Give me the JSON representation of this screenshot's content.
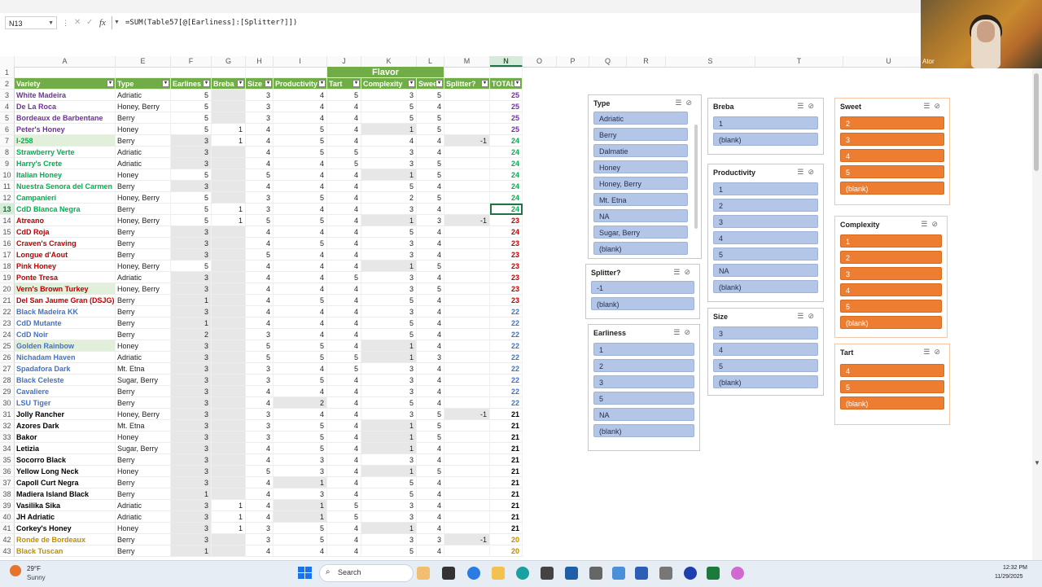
{
  "formula_bar": {
    "name_box": "N13",
    "formula": "=SUM(Table57[@[Earliness]:[Splitter?]])",
    "fx_label": "fx"
  },
  "columns": [
    "A",
    "E",
    "F",
    "G",
    "H",
    "I",
    "J",
    "K",
    "L",
    "M",
    "N",
    "O",
    "P",
    "Q",
    "R",
    "S",
    "T",
    "U"
  ],
  "selected_column": "N",
  "selected_row": "13",
  "flavor_header": "Flavor",
  "table_headers": [
    "Variety",
    "Type",
    "Earlines",
    "Breba",
    "Size",
    "Productivity",
    "Tart",
    "Complexity",
    "Swee",
    "Splitter?",
    "TOTAL"
  ],
  "rows": [
    {
      "n": "1",
      "cells": [
        "",
        "",
        "",
        "",
        "",
        "",
        "",
        "",
        "",
        "",
        ""
      ]
    },
    {
      "n": "2",
      "cells": [
        "",
        "",
        "",
        "",
        "",
        "",
        "",
        "",
        "",
        "",
        ""
      ]
    },
    {
      "n": "3",
      "cells": [
        "White Madeira",
        "Adriatic",
        "5",
        "",
        "3",
        "4",
        "5",
        "3",
        "5",
        "",
        "25"
      ],
      "color": "#7030a0"
    },
    {
      "n": "4",
      "cells": [
        "De La Roca",
        "Honey, Berry",
        "5",
        "",
        "3",
        "4",
        "4",
        "5",
        "4",
        "",
        "25"
      ],
      "color": "#7030a0"
    },
    {
      "n": "5",
      "cells": [
        "Bordeaux de Barbentane",
        "Berry",
        "5",
        "",
        "3",
        "4",
        "4",
        "5",
        "5",
        "",
        "25"
      ],
      "color": "#7030a0"
    },
    {
      "n": "6",
      "cells": [
        "Peter's Honey",
        "Honey",
        "5",
        "1",
        "4",
        "5",
        "4",
        "1",
        "5",
        "",
        "25"
      ],
      "color": "#7030a0"
    },
    {
      "n": "7",
      "cells": [
        "I-258",
        "Berry",
        "3",
        "1",
        "4",
        "5",
        "4",
        "4",
        "4",
        "-1",
        "24"
      ],
      "color": "#00b050"
    },
    {
      "n": "8",
      "cells": [
        "Strawberry Verte",
        "Adriatic",
        "3",
        "",
        "4",
        "5",
        "5",
        "3",
        "4",
        "",
        "24"
      ],
      "color": "#00b050"
    },
    {
      "n": "9",
      "cells": [
        "Harry's Crete",
        "Adriatic",
        "3",
        "",
        "4",
        "4",
        "5",
        "3",
        "5",
        "",
        "24"
      ],
      "color": "#00b050"
    },
    {
      "n": "10",
      "cells": [
        "Italian Honey",
        "Honey",
        "5",
        "",
        "5",
        "4",
        "4",
        "1",
        "5",
        "",
        "24"
      ],
      "color": "#00b050"
    },
    {
      "n": "11",
      "cells": [
        "Nuestra Senora del Carmen",
        "Berry",
        "3",
        "",
        "4",
        "4",
        "4",
        "5",
        "4",
        "",
        "24"
      ],
      "color": "#00b050"
    },
    {
      "n": "12",
      "cells": [
        "Campanieri",
        "Honey, Berry",
        "5",
        "",
        "3",
        "5",
        "4",
        "2",
        "5",
        "",
        "24"
      ],
      "color": "#00b050"
    },
    {
      "n": "13",
      "cells": [
        "CdD Blanca Negra",
        "Berry",
        "5",
        "1",
        "3",
        "4",
        "4",
        "3",
        "4",
        "",
        "24"
      ],
      "color": "#00b050"
    },
    {
      "n": "14",
      "cells": [
        "Atreano",
        "Honey, Berry",
        "5",
        "1",
        "5",
        "5",
        "4",
        "1",
        "3",
        "-1",
        "23"
      ],
      "color": "#c00000"
    },
    {
      "n": "15",
      "cells": [
        "CdD Roja",
        "Berry",
        "3",
        "",
        "4",
        "4",
        "4",
        "5",
        "4",
        "",
        "24"
      ],
      "color": "#c00000"
    },
    {
      "n": "16",
      "cells": [
        "Craven's Craving",
        "Berry",
        "3",
        "",
        "4",
        "5",
        "4",
        "3",
        "4",
        "",
        "23"
      ],
      "color": "#c00000"
    },
    {
      "n": "17",
      "cells": [
        "Longue d'Aout",
        "Berry",
        "3",
        "",
        "5",
        "4",
        "4",
        "3",
        "4",
        "",
        "23"
      ],
      "color": "#c00000"
    },
    {
      "n": "18",
      "cells": [
        "Pink Honey",
        "Honey, Berry",
        "5",
        "",
        "4",
        "4",
        "4",
        "1",
        "5",
        "",
        "23"
      ],
      "color": "#c00000"
    },
    {
      "n": "19",
      "cells": [
        "Ponte Tresa",
        "Adriatic",
        "3",
        "",
        "4",
        "4",
        "5",
        "3",
        "4",
        "",
        "23"
      ],
      "color": "#c00000"
    },
    {
      "n": "20",
      "cells": [
        "Vern's Brown Turkey",
        "Honey, Berry",
        "3",
        "",
        "4",
        "4",
        "4",
        "3",
        "5",
        "",
        "23"
      ],
      "color": "#c00000"
    },
    {
      "n": "21",
      "cells": [
        "Del San Jaume Gran (DSJG)",
        "Berry",
        "1",
        "",
        "4",
        "5",
        "4",
        "5",
        "4",
        "",
        "23"
      ],
      "color": "#c00000"
    },
    {
      "n": "22",
      "cells": [
        "Black Madeira KK",
        "Berry",
        "3",
        "",
        "4",
        "4",
        "4",
        "3",
        "4",
        "",
        "22"
      ],
      "color": "#4472c4"
    },
    {
      "n": "23",
      "cells": [
        "CdD Mutante",
        "Berry",
        "1",
        "",
        "4",
        "4",
        "4",
        "5",
        "4",
        "",
        "22"
      ],
      "color": "#4472c4"
    },
    {
      "n": "24",
      "cells": [
        "CdD Noir",
        "Berry",
        "2",
        "",
        "3",
        "4",
        "4",
        "5",
        "4",
        "",
        "22"
      ],
      "color": "#4472c4"
    },
    {
      "n": "25",
      "cells": [
        "Golden Rainbow",
        "Honey",
        "3",
        "",
        "5",
        "5",
        "4",
        "1",
        "4",
        "",
        "22"
      ],
      "color": "#4472c4"
    },
    {
      "n": "26",
      "cells": [
        "Nichadam Haven",
        "Adriatic",
        "3",
        "",
        "5",
        "5",
        "5",
        "1",
        "3",
        "",
        "22"
      ],
      "color": "#4472c4"
    },
    {
      "n": "27",
      "cells": [
        "Spadafora Dark",
        "Mt. Etna",
        "3",
        "",
        "3",
        "4",
        "5",
        "3",
        "4",
        "",
        "22"
      ],
      "color": "#4472c4"
    },
    {
      "n": "28",
      "cells": [
        "Black Celeste",
        "Sugar, Berry",
        "3",
        "",
        "3",
        "5",
        "4",
        "3",
        "4",
        "",
        "22"
      ],
      "color": "#4472c4"
    },
    {
      "n": "29",
      "cells": [
        "Cavaliere",
        "Berry",
        "3",
        "",
        "4",
        "4",
        "4",
        "3",
        "4",
        "",
        "22"
      ],
      "color": "#4472c4"
    },
    {
      "n": "30",
      "cells": [
        "LSU Tiger",
        "Berry",
        "3",
        "",
        "4",
        "2",
        "4",
        "5",
        "4",
        "",
        "22"
      ],
      "color": "#4472c4"
    },
    {
      "n": "31",
      "cells": [
        "Jolly Rancher",
        "Honey, Berry",
        "3",
        "",
        "3",
        "4",
        "4",
        "3",
        "5",
        "-1",
        "21"
      ],
      "color": "#000000"
    },
    {
      "n": "32",
      "cells": [
        "Azores Dark",
        "Mt. Etna",
        "3",
        "",
        "3",
        "5",
        "4",
        "1",
        "5",
        "",
        "21"
      ],
      "color": "#000000"
    },
    {
      "n": "33",
      "cells": [
        "Bakor",
        "Honey",
        "3",
        "",
        "3",
        "5",
        "4",
        "1",
        "5",
        "",
        "21"
      ],
      "color": "#000000"
    },
    {
      "n": "34",
      "cells": [
        "Letizia",
        "Sugar, Berry",
        "3",
        "",
        "4",
        "5",
        "4",
        "1",
        "4",
        "",
        "21"
      ],
      "color": "#000000"
    },
    {
      "n": "35",
      "cells": [
        "Socorro Black",
        "Berry",
        "3",
        "",
        "4",
        "3",
        "4",
        "3",
        "4",
        "",
        "21"
      ],
      "color": "#000000"
    },
    {
      "n": "36",
      "cells": [
        "Yellow Long Neck",
        "Honey",
        "3",
        "",
        "5",
        "3",
        "4",
        "1",
        "5",
        "",
        "21"
      ],
      "color": "#000000"
    },
    {
      "n": "37",
      "cells": [
        "Capoll Curt Negra",
        "Berry",
        "3",
        "",
        "4",
        "1",
        "4",
        "5",
        "4",
        "",
        "21"
      ],
      "color": "#000000"
    },
    {
      "n": "38",
      "cells": [
        "Madiera Island Black",
        "Berry",
        "1",
        "",
        "4",
        "3",
        "4",
        "5",
        "4",
        "",
        "21"
      ],
      "color": "#000000"
    },
    {
      "n": "39",
      "cells": [
        "Vasilika Sika",
        "Adriatic",
        "3",
        "1",
        "4",
        "1",
        "5",
        "3",
        "4",
        "",
        "21"
      ],
      "color": "#000000"
    },
    {
      "n": "40",
      "cells": [
        "JH Adriatic",
        "Adriatic",
        "3",
        "1",
        "4",
        "1",
        "5",
        "3",
        "4",
        "",
        "21"
      ],
      "color": "#000000"
    },
    {
      "n": "41",
      "cells": [
        "Corkey's Honey",
        "Honey",
        "3",
        "1",
        "3",
        "5",
        "4",
        "1",
        "4",
        "",
        "21"
      ],
      "color": "#000000"
    },
    {
      "n": "42",
      "cells": [
        "Ronde de Bordeaux",
        "Berry",
        "3",
        "",
        "3",
        "5",
        "4",
        "3",
        "3",
        "-1",
        "20"
      ],
      "color": "#bf8f00"
    },
    {
      "n": "43",
      "cells": [
        "Black Tuscan",
        "Berry",
        "1",
        "",
        "4",
        "4",
        "4",
        "5",
        "4",
        "",
        "20"
      ],
      "color": "#bf8f00"
    }
  ],
  "slicers": {
    "type": {
      "title": "Type",
      "items": [
        "Adriatic",
        "Berry",
        "Dalmatie",
        "Honey",
        "Honey, Berry",
        "Mt. Etna",
        "NA",
        "Sugar, Berry",
        "(blank)"
      ]
    },
    "splitter": {
      "title": "Splitter?",
      "items": [
        "-1",
        "(blank)"
      ]
    },
    "earliness": {
      "title": "Earliness",
      "items": [
        "1",
        "2",
        "3",
        "5",
        "NA",
        "(blank)"
      ]
    },
    "breba": {
      "title": "Breba",
      "items": [
        "1",
        "(blank)"
      ]
    },
    "productivity": {
      "title": "Productivity",
      "items": [
        "1",
        "2",
        "3",
        "4",
        "5",
        "NA",
        "(blank)"
      ]
    },
    "size": {
      "title": "Size",
      "items": [
        "3",
        "4",
        "5",
        "(blank)"
      ]
    },
    "sweet": {
      "title": "Sweet",
      "items": [
        "2",
        "3",
        "4",
        "5",
        "(blank)"
      ]
    },
    "complexity": {
      "title": "Complexity",
      "items": [
        "1",
        "2",
        "3",
        "4",
        "5",
        "(blank)"
      ]
    },
    "tart": {
      "title": "Tart",
      "items": [
        "4",
        "5",
        "(blank)"
      ]
    }
  },
  "webcam": {
    "label": "Ator"
  },
  "taskbar": {
    "weather_temp": "29°F",
    "weather_desc": "Sunny",
    "search_placeholder": "Search",
    "time": "12:32 PM",
    "date": "11/29/2025"
  },
  "colors": {
    "table_header": "#70ad47",
    "slicer_blue": "#b4c6e7",
    "slicer_orange": "#ed7d31",
    "excel_green": "#217346"
  }
}
